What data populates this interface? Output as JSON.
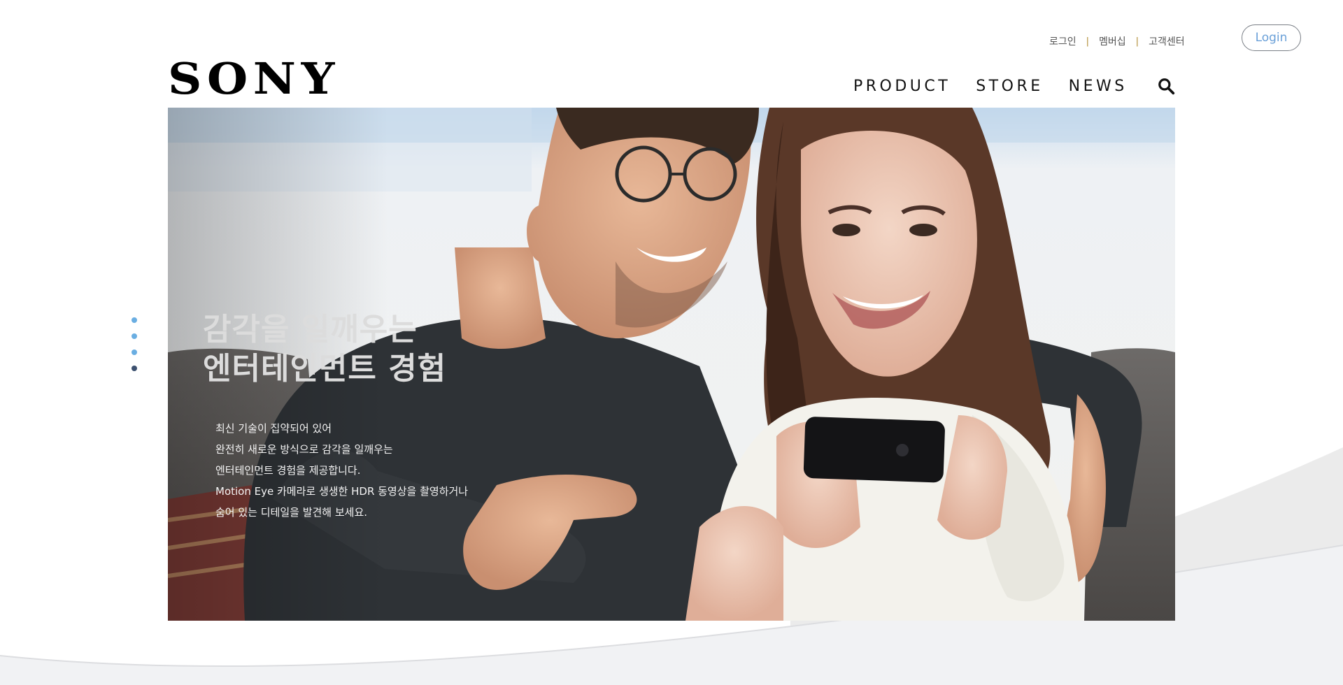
{
  "utility_nav": {
    "links": [
      "로그인",
      "멤버십",
      "고객센터"
    ],
    "separator": "|",
    "login_button": "Login"
  },
  "logo": {
    "text": "SONY"
  },
  "main_nav": {
    "items": [
      "PRODUCT",
      "STORE",
      "NEWS"
    ],
    "search_icon": "search-icon"
  },
  "hero": {
    "title_line1": "감각을 일깨우는",
    "title_line2": "엔터테인먼트 경험",
    "description": [
      "최신 기술이 집약되어 있어",
      "완전히 새로운 방식으로 감각을 일깨우는",
      "엔터테인먼트 경험을 제공합니다.",
      "Motion Eye 카메라로 생생한 HDR 동영상을 촬영하거나",
      "숨어 있는 디테일을 발견해 보세요."
    ],
    "image": "couple-watching-smartphone"
  },
  "slider": {
    "dot_count": 4,
    "active_index": 3
  },
  "colors": {
    "accent": "#6aa0d8",
    "dot": "#6aaee2",
    "dot_active": "#3d5170",
    "separator": "#b08a2e"
  }
}
